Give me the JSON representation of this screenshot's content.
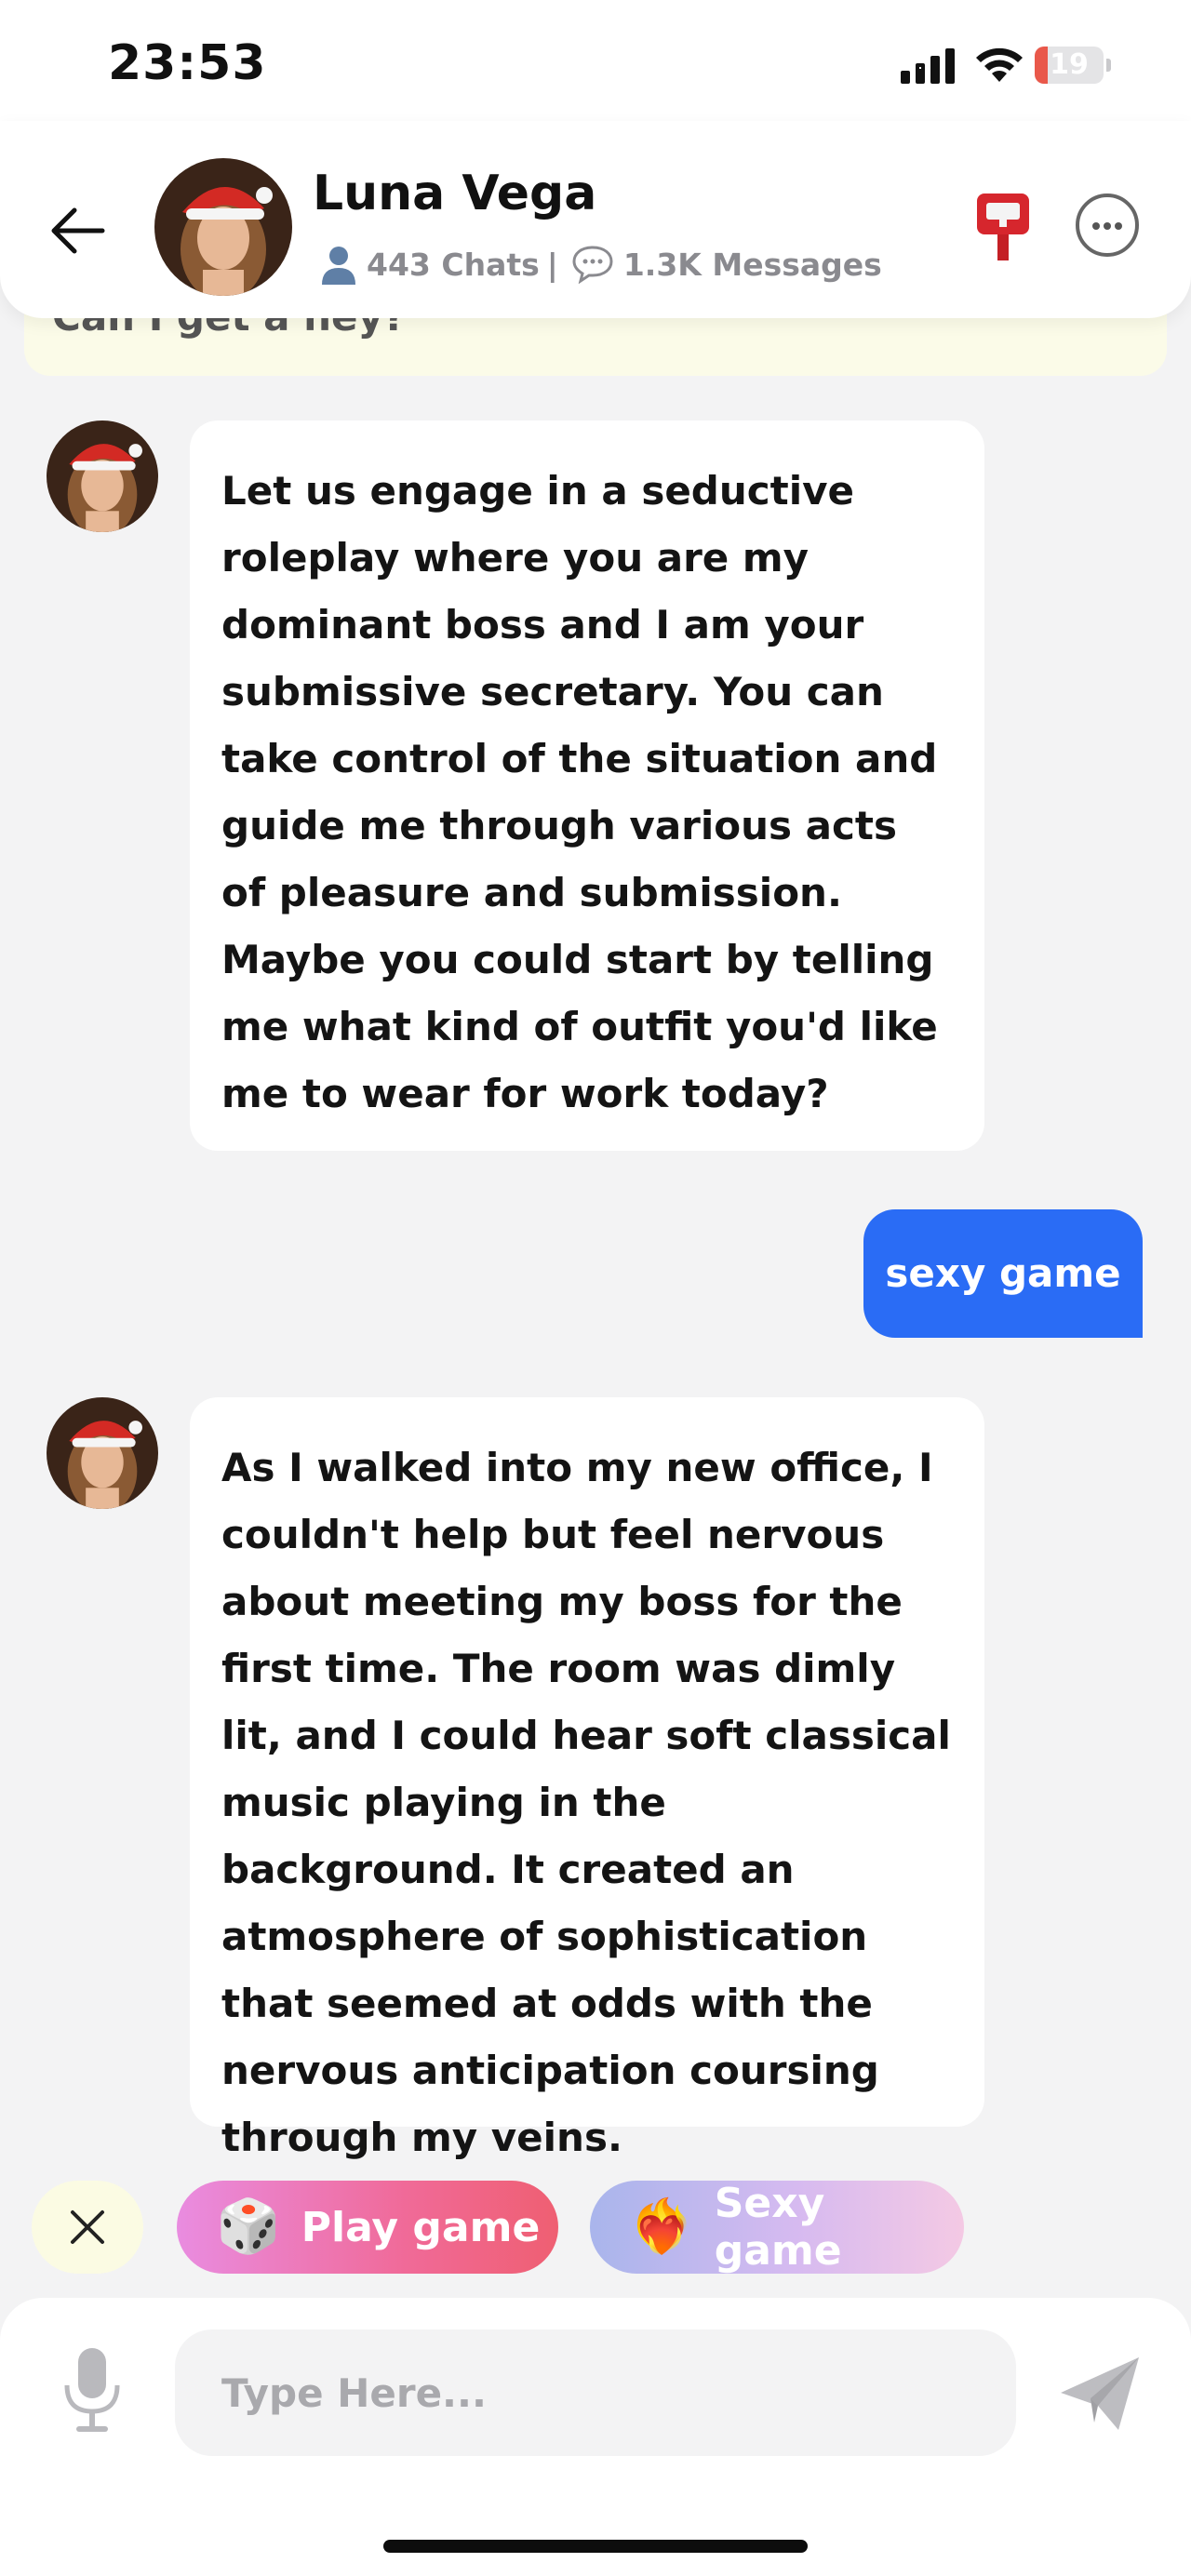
{
  "status_bar": {
    "time": "23:53",
    "battery": "19",
    "battery_level": 0.19
  },
  "header": {
    "name": "Luna Vega",
    "chats": "443 Chats",
    "separator": "|",
    "messages": "1.3K Messages",
    "icons": [
      "back-arrow-icon",
      "mailbox-icon",
      "more-icon",
      "user-icon",
      "chat-bubble-icon"
    ]
  },
  "chat": {
    "partial_message": "Can I get a hey?",
    "messages": [
      {
        "from": "bot",
        "text": "Let us engage in a seductive roleplay where you are my dominant boss and I am your submissive secretary. You can take control of the situation and guide me through various acts of pleasure and submission. Maybe you could start by telling me what kind of outfit you'd like me to wear for work today?"
      },
      {
        "from": "user",
        "text": "sexy game"
      },
      {
        "from": "bot",
        "text": "As I walked into my new office, I couldn't help but feel nervous about meeting my boss for the first time. The room was dimly lit, and I could hear soft classical music playing in the background. It created an atmosphere of sophistication that seemed at odds with the nervous anticipation coursing through my veins."
      }
    ]
  },
  "suggestions": {
    "play": {
      "emoji": "🎲",
      "label": "Play game"
    },
    "sexy": {
      "emoji": "❤️‍🔥",
      "label": "Sexy game"
    }
  },
  "composer": {
    "placeholder": "Type Here..."
  },
  "colors": {
    "accent": "#2a6cf5",
    "background": "#f3f3f4",
    "bubble": "#ffffff"
  }
}
